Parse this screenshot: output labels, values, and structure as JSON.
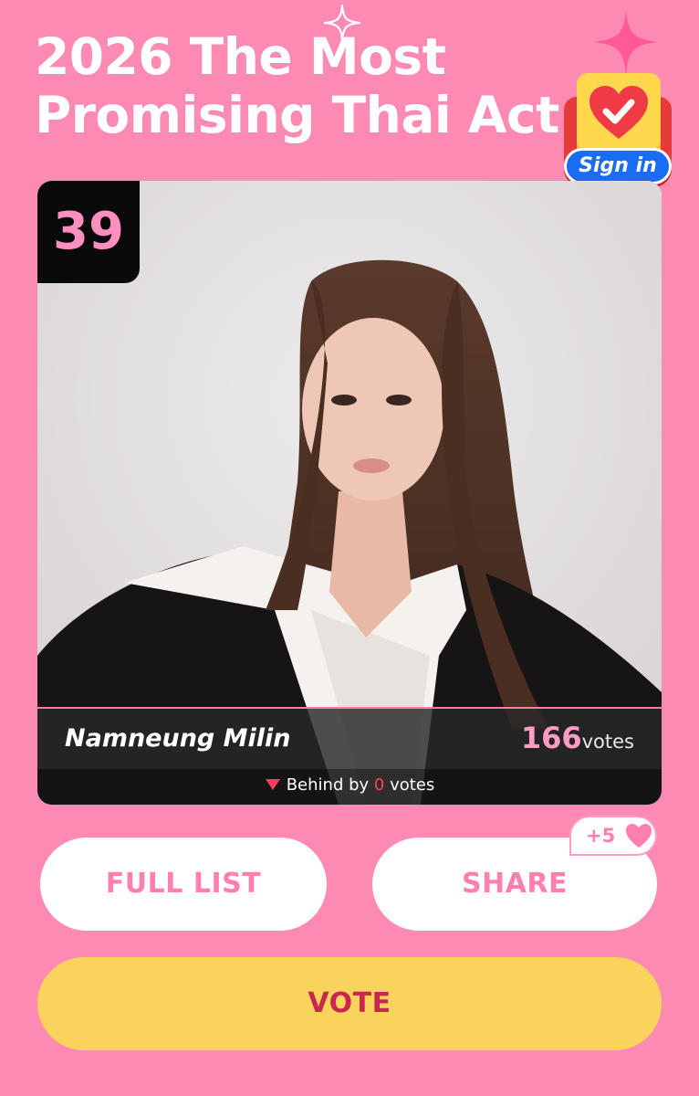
{
  "header": {
    "title_line1": "2026 The Most",
    "title_line2": "Promising Thai Act",
    "signin_label": "Sign in"
  },
  "card": {
    "rank": "39",
    "name": "Namneung Milin",
    "vote_count": "166",
    "vote_unit": "votes",
    "behind_prefix": "Behind by",
    "behind_value": "0",
    "behind_suffix": "votes"
  },
  "actions": {
    "full_list": "FULL LIST",
    "share": "SHARE",
    "share_bonus": "+5",
    "vote": "VOTE"
  },
  "colors": {
    "background": "#fd8ab3",
    "accent_pink": "#ff7faf",
    "vote_yellow": "#fad35c",
    "vote_text": "#c8284f",
    "signin_blue": "#1a6cf2"
  },
  "icons": [
    "sparkle-icon",
    "heart-check-icon",
    "triangle-down-icon",
    "heart-icon"
  ]
}
